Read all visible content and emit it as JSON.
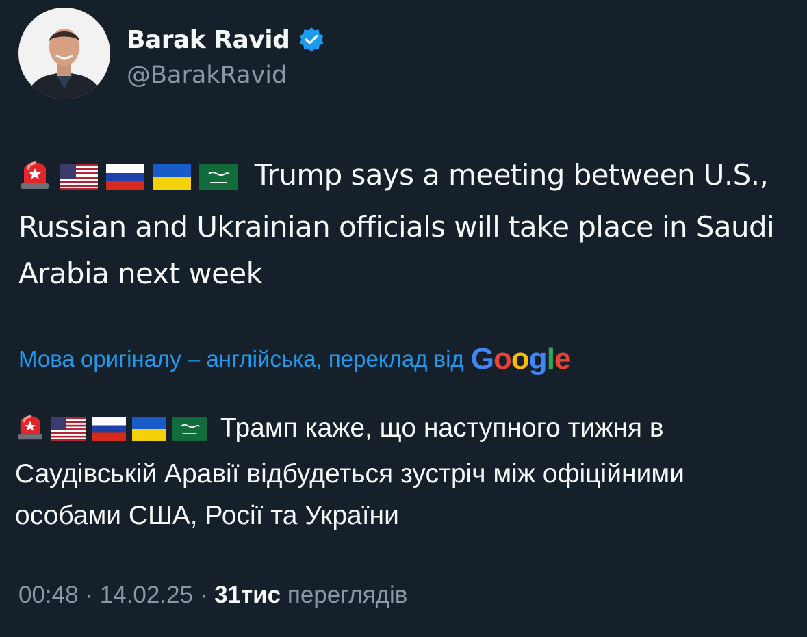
{
  "author": {
    "display_name": "Barak Ravid",
    "handle": "@BarakRavid",
    "verified": true,
    "verified_color": "#1d9bf0"
  },
  "tweet": {
    "emojis": [
      "rotating-light-emoji",
      "us-flag-emoji",
      "russia-flag-emoji",
      "ukraine-flag-emoji",
      "saudi-flag-emoji"
    ],
    "text": "Trump says a meeting between U.S., Russian and Ukrainian officials will take place in Saudi Arabia next week"
  },
  "translation": {
    "label": "Мова оригіналу – англійська, переклад від",
    "provider": "Google",
    "text": "Трамп каже, що наступного тижня в Саудівській Аравії відбудеться зустріч між офіційними особами США, Росії та України"
  },
  "meta": {
    "time": "00:48",
    "date": "14.02.25",
    "separator": "·",
    "views_count": "31тис",
    "views_label": "переглядів"
  },
  "colors": {
    "background": "#15202b",
    "text_primary": "#f7f9f9",
    "text_secondary": "#8b98a5",
    "link": "#1d9bf0"
  }
}
